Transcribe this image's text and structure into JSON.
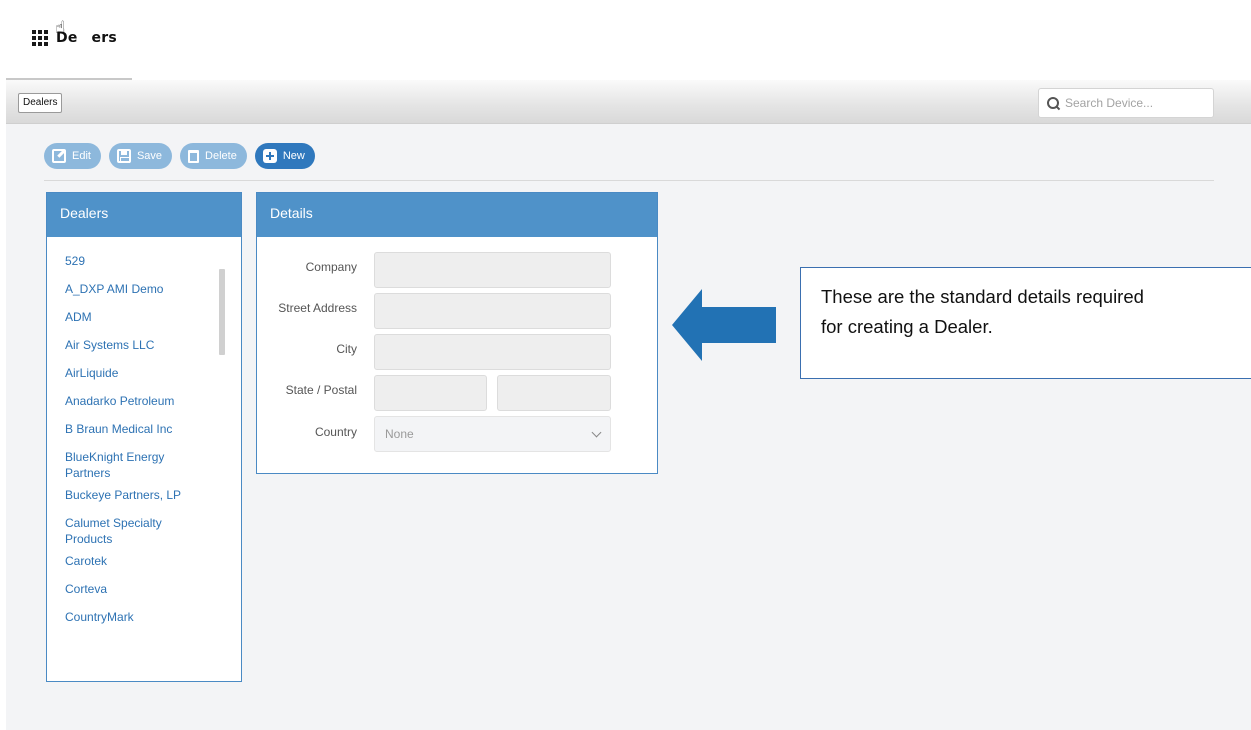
{
  "app": {
    "title": "Dealers",
    "title_prefix": "De",
    "title_suffix": "ers"
  },
  "breadcrumb": {
    "current": "Dealers"
  },
  "search": {
    "placeholder": "Search Device..."
  },
  "toolbar": {
    "edit_label": "Edit",
    "save_label": "Save",
    "delete_label": "Delete",
    "new_label": "New"
  },
  "dealers_panel": {
    "title": "Dealers",
    "items": [
      "529",
      "A_DXP AMI Demo",
      "ADM",
      "Air Systems LLC",
      "AirLiquide",
      "Anadarko Petroleum",
      "B Braun Medical Inc",
      "BlueKnight Energy Partners",
      "Buckeye Partners, LP",
      "Calumet Specialty Products",
      "Carotek",
      "Corteva",
      "CountryMark"
    ]
  },
  "details_panel": {
    "title": "Details",
    "fields": {
      "company": "Company",
      "street": "Street Address",
      "city": "City",
      "state_postal": "State / Postal",
      "country": "Country"
    },
    "country_value": "None"
  },
  "callout": {
    "line1": "These are the standard details required",
    "line2": "for creating a Dealer."
  },
  "colors": {
    "accent": "#4f92c9",
    "primary_button": "#2f78bd",
    "disabled_button": "#8db8dc",
    "link": "#2d72b3",
    "callout_arrow": "#2272b4"
  }
}
